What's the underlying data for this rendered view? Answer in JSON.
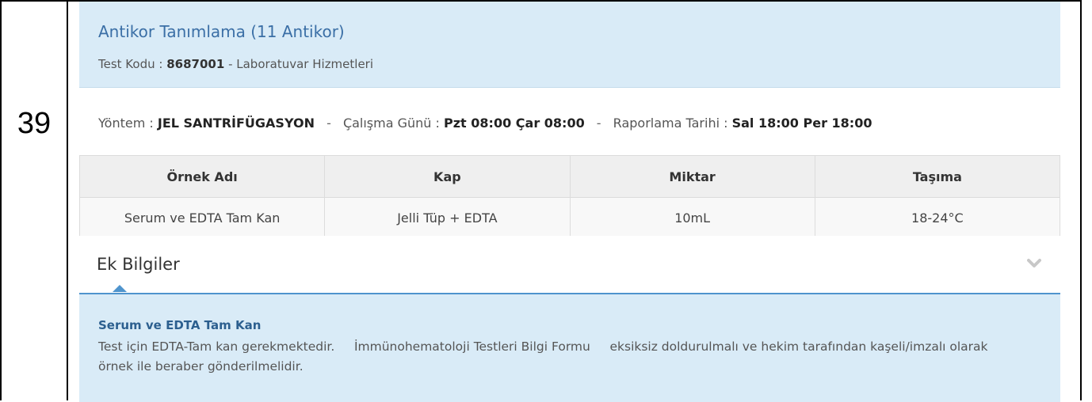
{
  "row_number": "39",
  "card": {
    "title": "Antikor Tanımlama (11 Antikor)",
    "test_code_label": "Test Kodu :",
    "test_code": "8687001",
    "test_code_suffix": "- Laboratuvar Hizmetleri"
  },
  "method": {
    "method_label": "Yöntem :",
    "method_value": "JEL SANTRİFÜGASYON",
    "separator": "-",
    "workday_label": "Çalışma Günü :",
    "workday_value": "Pzt 08:00 Çar 08:00",
    "report_label": "Raporlama Tarihi :",
    "report_value": "Sal 18:00 Per 18:00"
  },
  "samples_table": {
    "headers": [
      "Örnek Adı",
      "Kap",
      "Miktar",
      "Taşıma"
    ],
    "rows": [
      [
        "Serum ve EDTA Tam Kan",
        "Jelli Tüp + EDTA",
        "10mL",
        "18-24°C"
      ]
    ]
  },
  "extra_info": {
    "title": "Ek Bilgiler",
    "chevron_icon": "chevron-down-icon",
    "heading": "Serum ve EDTA Tam Kan",
    "text": "Test için EDTA-Tam kan gerekmektedir.     İmmünohematoloji Testleri Bilgi Formu     eksiksiz doldurulmalı ve hekim tarafından kaşeli/imzalı olarak örnek ile beraber gönderilmelidir."
  },
  "colors": {
    "header_bg": "#d9ebf7",
    "title_blue": "#3b6fa6",
    "accent_line": "#4f94cd"
  }
}
